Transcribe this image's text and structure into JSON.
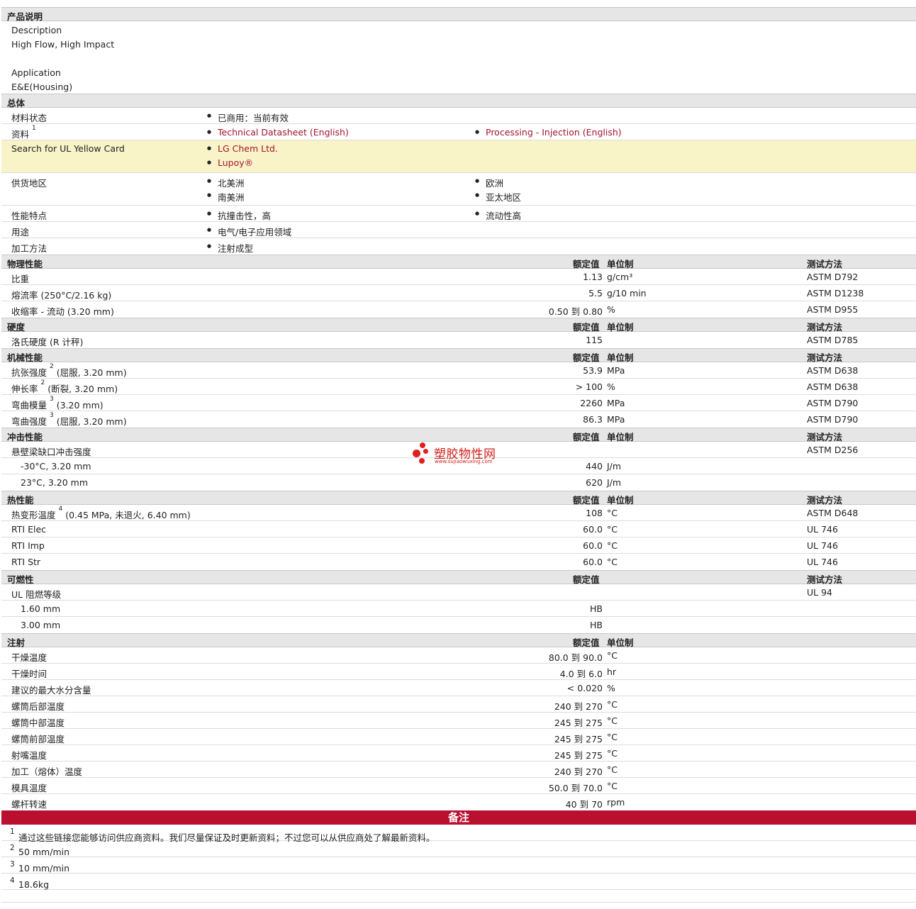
{
  "product": {
    "title": "产品说明",
    "desc_label": "Description",
    "desc_value": "High Flow, High Impact",
    "app_label": "Application",
    "app_value": "E&E(Housing)"
  },
  "general": {
    "title": "总体",
    "status_label": "材料状态",
    "status_value": "已商用：当前有效",
    "docs_label": "资料",
    "docs_sup": "1",
    "docs_link1": "Technical Datasheet (English)",
    "docs_link2": "Processing - Injection (English)",
    "ul_label": "Search for UL Yellow Card",
    "ul_link1": "LG Chem Ltd.",
    "ul_link2": "Lupoy®",
    "region_label": "供货地区",
    "region1": "北美洲",
    "region2": "欧洲",
    "region3": "南美洲",
    "region4": "亚太地区",
    "feature_label": "性能特点",
    "feature1": "抗撞击性，高",
    "feature2": "流动性高",
    "use_label": "用途",
    "use1": "电气/电子应用领域",
    "process_label": "加工方法",
    "process1": "注射成型"
  },
  "headers": {
    "rated": "额定值",
    "unit": "单位制",
    "method": "测试方法"
  },
  "physical": {
    "title": "物理性能",
    "rows": [
      {
        "label": "比重",
        "value": "1.13",
        "unit": "g/cm³",
        "method": "ASTM D792"
      },
      {
        "label": "熔流率 (250°C/2.16 kg)",
        "value": "5.5",
        "unit": "g/10 min",
        "method": "ASTM D1238"
      },
      {
        "label": "收缩率 - 流动 (3.20 mm)",
        "value": "0.50 到  0.80",
        "unit": "%",
        "method": "ASTM D955"
      }
    ]
  },
  "hardness": {
    "title": "硬度",
    "rows": [
      {
        "label": "洛氏硬度 (R 计秤)",
        "value": "115",
        "unit": "",
        "method": "ASTM D785"
      }
    ]
  },
  "mechanical": {
    "title": "机械性能",
    "rows": [
      {
        "label": "抗张强度",
        "sup": "2",
        "suffix": " (屈服, 3.20 mm)",
        "value": "53.9",
        "unit": "MPa",
        "method": "ASTM D638"
      },
      {
        "label": "伸长率",
        "sup": "2",
        "suffix": " (断裂, 3.20 mm)",
        "value": "> 100",
        "unit": "%",
        "method": "ASTM D638"
      },
      {
        "label": "弯曲模量",
        "sup": "3",
        "suffix": " (3.20 mm)",
        "value": "2260",
        "unit": "MPa",
        "method": "ASTM D790"
      },
      {
        "label": "弯曲强度",
        "sup": "3",
        "suffix": " (屈服, 3.20 mm)",
        "value": "86.3",
        "unit": "MPa",
        "method": "ASTM D790"
      }
    ]
  },
  "impact": {
    "title": "冲击性能",
    "rows": [
      {
        "label": "悬壁梁缺口冲击强度",
        "value": "",
        "unit": "",
        "method": "ASTM D256"
      },
      {
        "label": "-30°C, 3.20 mm",
        "value": "440",
        "unit": "J/m",
        "method": ""
      },
      {
        "label": "23°C, 3.20 mm",
        "value": "620",
        "unit": "J/m",
        "method": ""
      }
    ]
  },
  "thermal": {
    "title": "热性能",
    "rows": [
      {
        "label": "热变形温度",
        "sup": "4",
        "suffix": " (0.45 MPa, 未退火, 6.40 mm)",
        "value": "108",
        "unit": "°C",
        "method": "ASTM D648"
      },
      {
        "label": "RTI Elec",
        "value": "60.0",
        "unit": "°C",
        "method": "UL 746"
      },
      {
        "label": "RTI Imp",
        "value": "60.0",
        "unit": "°C",
        "method": "UL 746"
      },
      {
        "label": "RTI Str",
        "value": "60.0",
        "unit": "°C",
        "method": "UL 746"
      }
    ]
  },
  "flammability": {
    "title": "可燃性",
    "rows": [
      {
        "label": "UL 阻燃等级",
        "value": "",
        "unit": "",
        "method": "UL 94"
      },
      {
        "label": "1.60 mm",
        "value": "HB",
        "unit": "",
        "method": ""
      },
      {
        "label": "3.00 mm",
        "value": "HB",
        "unit": "",
        "method": ""
      }
    ]
  },
  "injection": {
    "title": "注射",
    "rows": [
      {
        "label": "干燥温度",
        "value": "80.0 到  90.0",
        "unit": "°C"
      },
      {
        "label": "干燥时间",
        "value": "4.0 到  6.0",
        "unit": "hr"
      },
      {
        "label": "建议的最大水分含量",
        "value": "< 0.020",
        "unit": "%"
      },
      {
        "label": "螺筒后部温度",
        "value": "240 到  270",
        "unit": "°C"
      },
      {
        "label": "螺筒中部温度",
        "value": "245 到  275",
        "unit": "°C"
      },
      {
        "label": "螺筒前部温度",
        "value": "245 到  275",
        "unit": "°C"
      },
      {
        "label": "射嘴温度",
        "value": "245 到  275",
        "unit": "°C"
      },
      {
        "label": "加工（熔体）温度",
        "value": "240 到  270",
        "unit": "°C"
      },
      {
        "label": "模具温度",
        "value": "50.0 到  70.0",
        "unit": "°C"
      },
      {
        "label": "螺杆转速",
        "value": "40 到  70",
        "unit": "rpm"
      }
    ]
  },
  "notes": {
    "title": "备注",
    "items": [
      {
        "sup": "1",
        "text": "通过这些链接您能够访问供应商资料。我们尽量保证及时更新资料；不过您可以从供应商处了解最新资料。"
      },
      {
        "sup": "2",
        "text": "50 mm/min"
      },
      {
        "sup": "3",
        "text": "10 mm/min"
      },
      {
        "sup": "4",
        "text": "18.6kg"
      }
    ]
  },
  "watermark": {
    "name": "塑胶物性网",
    "url": "www.sujiaowuxing.com"
  }
}
